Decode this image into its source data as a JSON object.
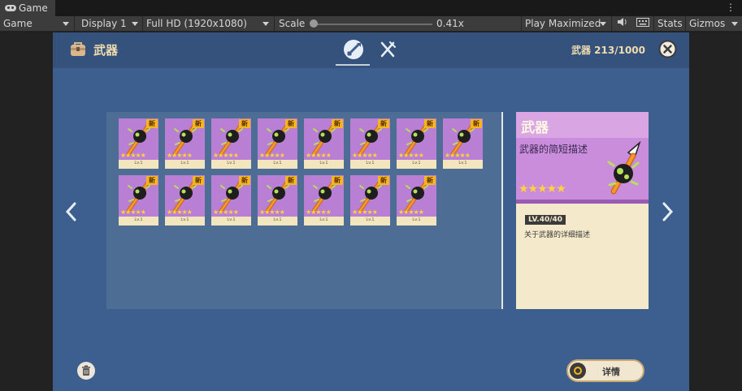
{
  "editor": {
    "tab_label": "Game",
    "toolbar": {
      "display_select": "Game",
      "display_number": "Display 1",
      "resolution": "Full HD (1920x1080)",
      "scale_label": "Scale",
      "scale_value": "0.41x",
      "scale_fraction": 0.41,
      "play_mode": "Play Maximized",
      "stats": "Stats",
      "gizmos": "Gizmos"
    }
  },
  "inventory": {
    "title": "武器",
    "count_label": "武器 213/1000",
    "tabs": [
      {
        "icon": "weapon-tab-icon",
        "active": true
      },
      {
        "icon": "utensils-tab-icon",
        "active": false
      }
    ],
    "items": [
      {
        "badge": "新",
        "level": "Lv.1",
        "stars": "★★★★★"
      },
      {
        "badge": "新",
        "level": "Lv.1",
        "stars": "★★★★★"
      },
      {
        "badge": "新",
        "level": "Lv.1",
        "stars": "★★★★★"
      },
      {
        "badge": "新",
        "level": "Lv.1",
        "stars": "★★★★★"
      },
      {
        "badge": "新",
        "level": "Lv.1",
        "stars": "★★★★★"
      },
      {
        "badge": "新",
        "level": "Lv.1",
        "stars": "★★★★★"
      },
      {
        "badge": "新",
        "level": "Lv.1",
        "stars": "★★★★★"
      },
      {
        "badge": "新",
        "level": "Lv.1",
        "stars": "★★★★★"
      },
      {
        "badge": "新",
        "level": "Lv.1",
        "stars": "★★★★★"
      },
      {
        "badge": "新",
        "level": "Lv.1",
        "stars": "★★★★★"
      },
      {
        "badge": "新",
        "level": "Lv.1",
        "stars": "★★★★★"
      },
      {
        "badge": "新",
        "level": "Lv.1",
        "stars": "★★★★★"
      },
      {
        "badge": "新",
        "level": "Lv.1",
        "stars": "★★★★★"
      },
      {
        "badge": "新",
        "level": "Lv.1",
        "stars": "★★★★★"
      },
      {
        "badge": "新",
        "level": "Lv.1",
        "stars": "★★★★★"
      }
    ],
    "detail": {
      "name": "武器",
      "short_desc": "武器的简短描述",
      "stars": "★★★★★",
      "level": "LV.40/40",
      "long_desc": "关于武器的详细描述"
    },
    "toggle_label": "详情"
  },
  "colors": {
    "panel_bg": "#3d5f8f",
    "card_art": "#b97fd4",
    "badge": "#f4b521",
    "accent_text": "#f0dcae"
  }
}
